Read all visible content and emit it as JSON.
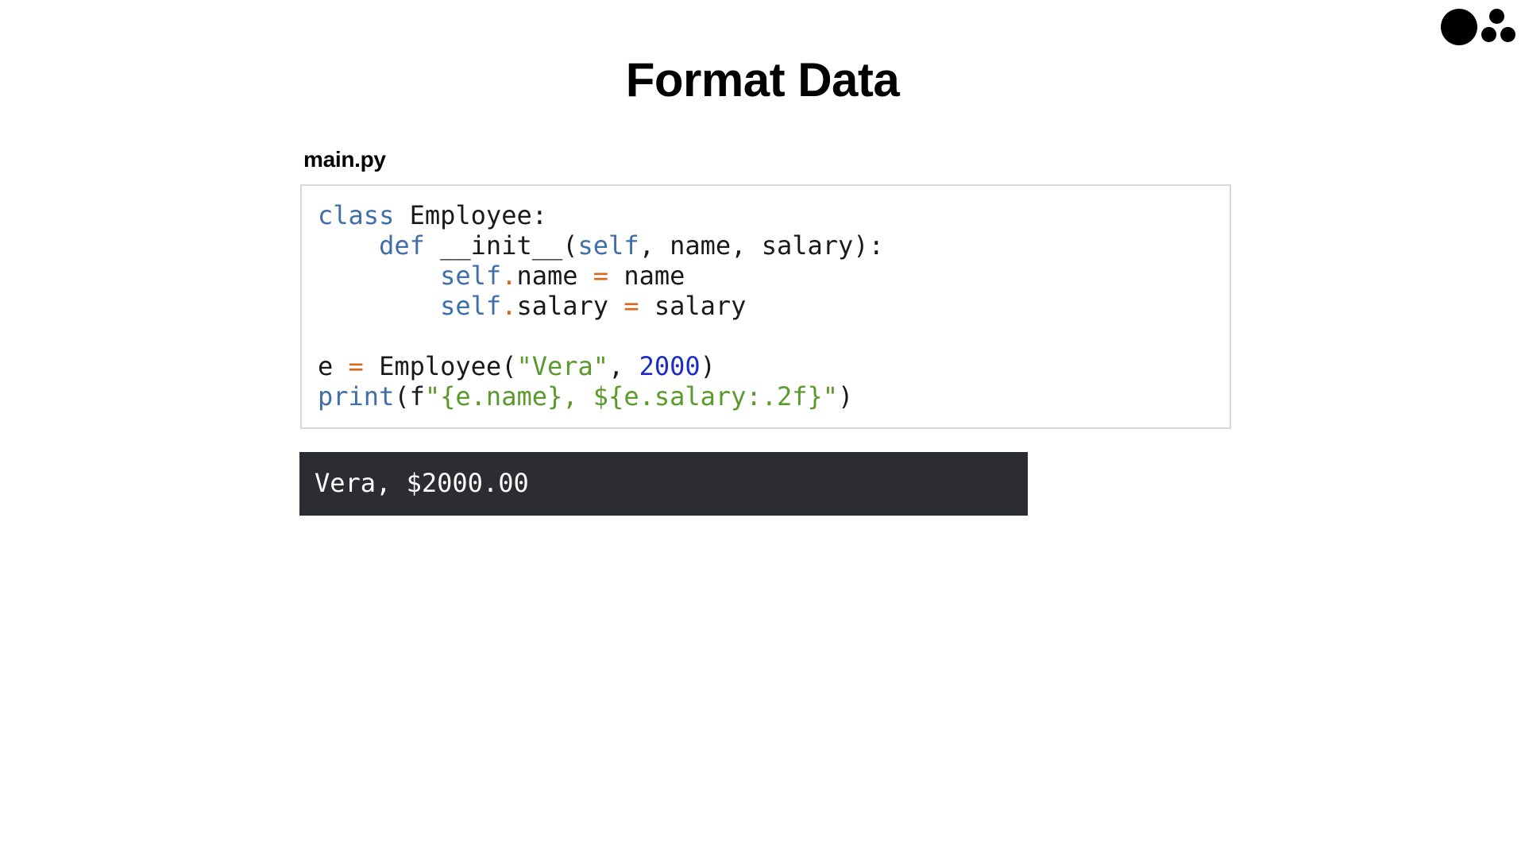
{
  "slide": {
    "title": "Format Data",
    "logo_icon": "dots-logo-icon"
  },
  "editor": {
    "filename": "main.py",
    "lines": [
      [
        {
          "t": "class",
          "c": "kw"
        },
        {
          "t": " Employee:",
          "c": ""
        }
      ],
      [
        {
          "t": "    ",
          "c": ""
        },
        {
          "t": "def",
          "c": "kw"
        },
        {
          "t": " __init__(",
          "c": ""
        },
        {
          "t": "self",
          "c": "kw"
        },
        {
          "t": ", name, salary):",
          "c": ""
        }
      ],
      [
        {
          "t": "        ",
          "c": ""
        },
        {
          "t": "self",
          "c": "kw"
        },
        {
          "t": ".",
          "c": "op"
        },
        {
          "t": "name ",
          "c": ""
        },
        {
          "t": "=",
          "c": "op"
        },
        {
          "t": " name",
          "c": ""
        }
      ],
      [
        {
          "t": "        ",
          "c": ""
        },
        {
          "t": "self",
          "c": "kw"
        },
        {
          "t": ".",
          "c": "op"
        },
        {
          "t": "salary ",
          "c": ""
        },
        {
          "t": "=",
          "c": "op"
        },
        {
          "t": " salary",
          "c": ""
        }
      ],
      [],
      [
        {
          "t": "e ",
          "c": ""
        },
        {
          "t": "=",
          "c": "op"
        },
        {
          "t": " Employee(",
          "c": ""
        },
        {
          "t": "\"Vera\"",
          "c": "str"
        },
        {
          "t": ", ",
          "c": ""
        },
        {
          "t": "2000",
          "c": "num"
        },
        {
          "t": ")",
          "c": ""
        }
      ],
      [
        {
          "t": "print",
          "c": "kw"
        },
        {
          "t": "(f",
          "c": ""
        },
        {
          "t": "\"{e.name}, ${e.salary:.2f}\"",
          "c": "str"
        },
        {
          "t": ")",
          "c": ""
        }
      ]
    ]
  },
  "output": {
    "text": "Vera, $2000.00"
  }
}
